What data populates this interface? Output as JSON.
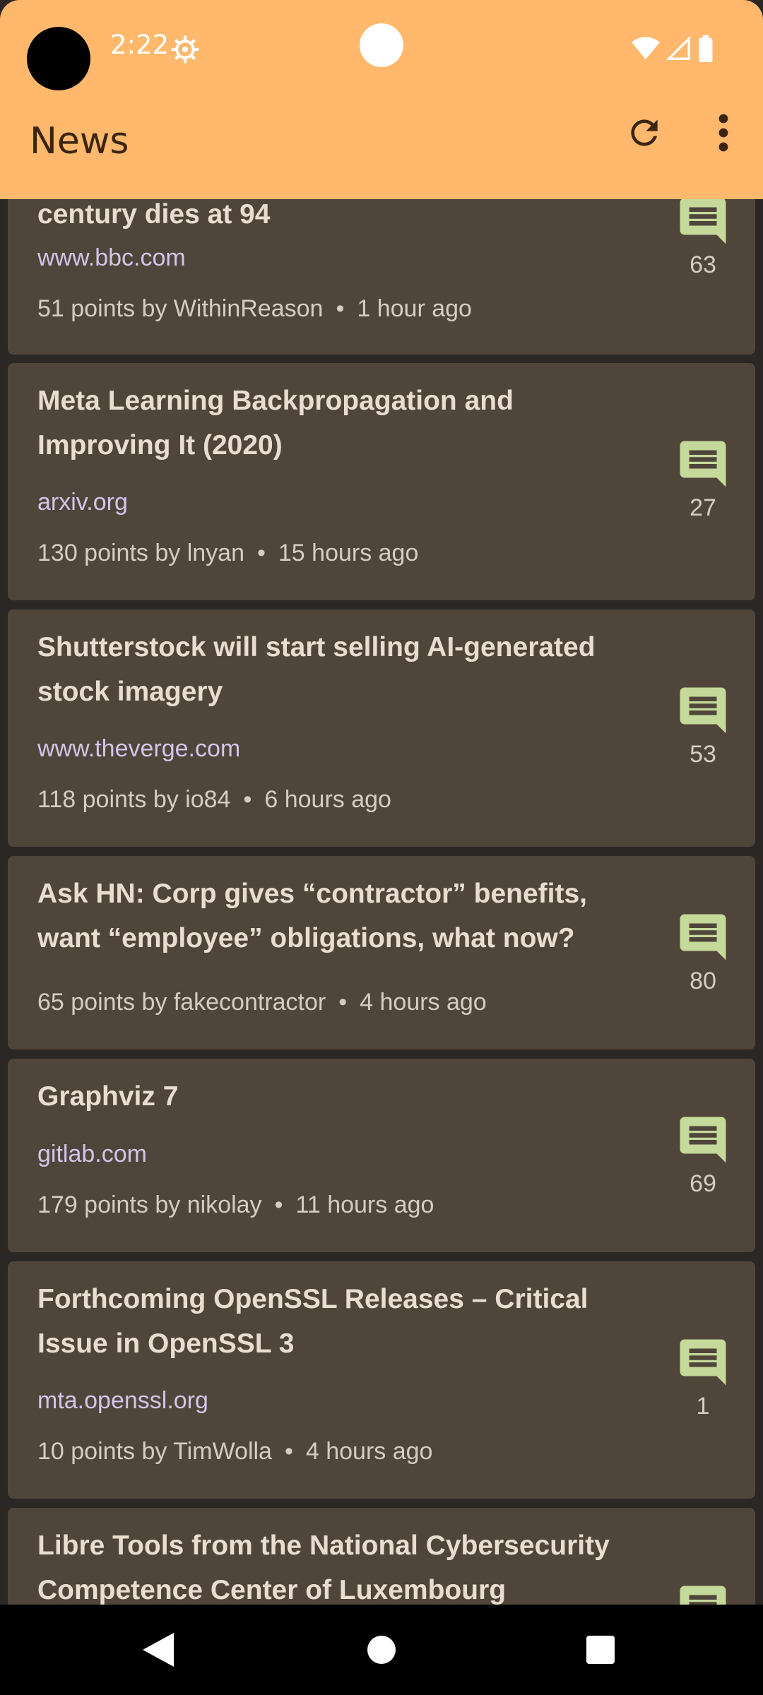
{
  "status_bar": {
    "time": "2:22"
  },
  "app_bar": {
    "title": "News"
  },
  "colors": {
    "app_bar_bg": "#ffb86c",
    "card_bg": "#50453b",
    "comment_icon": "#c5d99a",
    "domain_text": "#d6c3e8"
  },
  "stories": [
    {
      "title_lines": [
        "century dies at 94"
      ],
      "domain": "www.bbc.com",
      "points_by": "51 points by WithinReason",
      "age": "1 hour ago",
      "comments": "63"
    },
    {
      "title_lines": [
        "Meta Learning Backpropagation and",
        "Improving It (2020)"
      ],
      "domain": "arxiv.org",
      "points_by": "130 points by lnyan",
      "age": "15 hours ago",
      "comments": "27"
    },
    {
      "title_lines": [
        "Shutterstock will start selling AI-generated",
        "stock imagery"
      ],
      "domain": "www.theverge.com",
      "points_by": "118 points by io84",
      "age": "6 hours ago",
      "comments": "53"
    },
    {
      "title_lines": [
        "Ask HN: Corp gives “contractor” benefits,",
        "want “employee” obligations, what now?"
      ],
      "domain": "",
      "points_by": "65 points by fakecontractor",
      "age": "4 hours ago",
      "comments": "80"
    },
    {
      "title_lines": [
        "Graphviz 7"
      ],
      "domain": "gitlab.com",
      "points_by": "179 points by nikolay",
      "age": "11 hours ago",
      "comments": "69"
    },
    {
      "title_lines": [
        "Forthcoming OpenSSL Releases – Critical",
        "Issue in OpenSSL 3"
      ],
      "domain": "mta.openssl.org",
      "points_by": "10 points by TimWolla",
      "age": "4 hours ago",
      "comments": "1"
    },
    {
      "title_lines": [
        "Libre Tools from the National Cybersecurity",
        "Competence Center of Luxembourg"
      ],
      "domain": "",
      "points_by": "",
      "age": "",
      "comments": ""
    }
  ]
}
